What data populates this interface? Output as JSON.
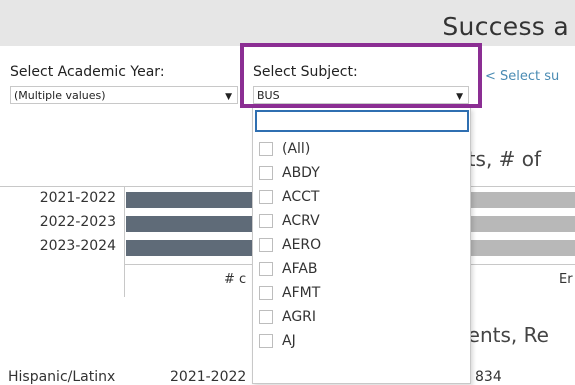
{
  "header": {
    "title": "Success a"
  },
  "filters": {
    "academic_year": {
      "label": "Select Academic Year:",
      "value": "(Multiple values)"
    },
    "subject": {
      "label": "Select Subject:",
      "value": "BUS"
    },
    "hint": "< Select su"
  },
  "chart1": {
    "title": "nts, # of",
    "rows": [
      "2021-2022",
      "2022-2023",
      "2023-2024"
    ],
    "axis_left": "# c",
    "axis_right": "Er"
  },
  "chart2": {
    "title": "nents, Re"
  },
  "bottom_row": {
    "group": "Hispanic/Latinx",
    "year": "2021-2022",
    "value": "834"
  },
  "dropdown": {
    "options": [
      "(All)",
      "ABDY",
      "ACCT",
      "ACRV",
      "AERO",
      "AFAB",
      "AFMT",
      "AGRI",
      "AJ"
    ]
  },
  "colors": {
    "highlight": "#8b2e93",
    "bar": "#5f6b78",
    "search_border": "#2f6fb1"
  }
}
